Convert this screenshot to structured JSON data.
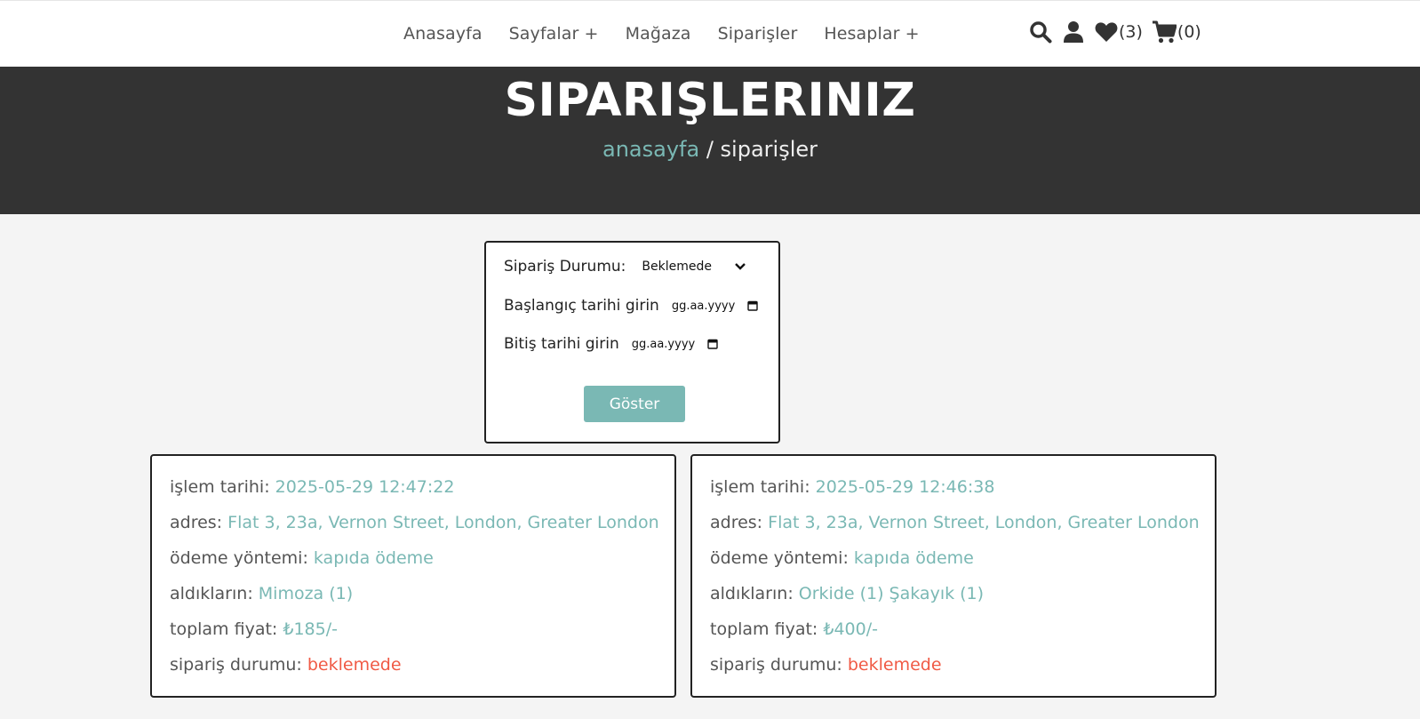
{
  "nav": {
    "items": [
      "Anasayfa",
      "Sayfalar +",
      "Mağaza",
      "Siparişler",
      "Hesaplar +"
    ]
  },
  "header_icons": {
    "search": "search-icon",
    "user": "user-icon",
    "wishlist": {
      "icon": "heart-icon",
      "count": "(3)"
    },
    "cart": {
      "icon": "cart-icon",
      "count": "(0)"
    }
  },
  "hero": {
    "title": "SIPARIŞLERINIZ",
    "breadcrumb_home": "anasayfa",
    "breadcrumb_sep": " / ",
    "breadcrumb_current": "siparişler"
  },
  "filter": {
    "status_label": "Sipariş Durumu:",
    "status_value": "Beklemede",
    "start_label": "Başlangıç tarihi girin",
    "start_placeholder": "gg.aa.yyyy",
    "end_label": "Bitiş tarihi girin",
    "end_placeholder": "gg.aa.yyyy",
    "submit_label": "Göster"
  },
  "orders": [
    {
      "date_label": "işlem tarihi: ",
      "date": "2025-05-29 12:47:22",
      "address_label": "adres: ",
      "address": "Flat 3, 23a, Vernon Street, London, Greater London",
      "payment_label": "ödeme yöntemi: ",
      "payment": "kapıda ödeme",
      "items_label": "aldıkların: ",
      "items": "Mimoza (1)",
      "total_label": "toplam fiyat: ",
      "total": "₺185/-",
      "status_label": "sipariş durumu: ",
      "status": "beklemede"
    },
    {
      "date_label": "işlem tarihi: ",
      "date": "2025-05-29 12:46:38",
      "address_label": "adres: ",
      "address": "Flat 3, 23a, Vernon Street, London, Greater London",
      "payment_label": "ödeme yöntemi: ",
      "payment": "kapıda ödeme",
      "items_label": "aldıkların: ",
      "items": "Orkide (1) Şakayık (1)",
      "total_label": "toplam fiyat: ",
      "total": "₺400/-",
      "status_label": "sipariş durumu: ",
      "status": "beklemede"
    }
  ],
  "colors": {
    "accent": "#7ab8b4",
    "status_pending": "#f05a45",
    "hero_bg": "#333333"
  }
}
